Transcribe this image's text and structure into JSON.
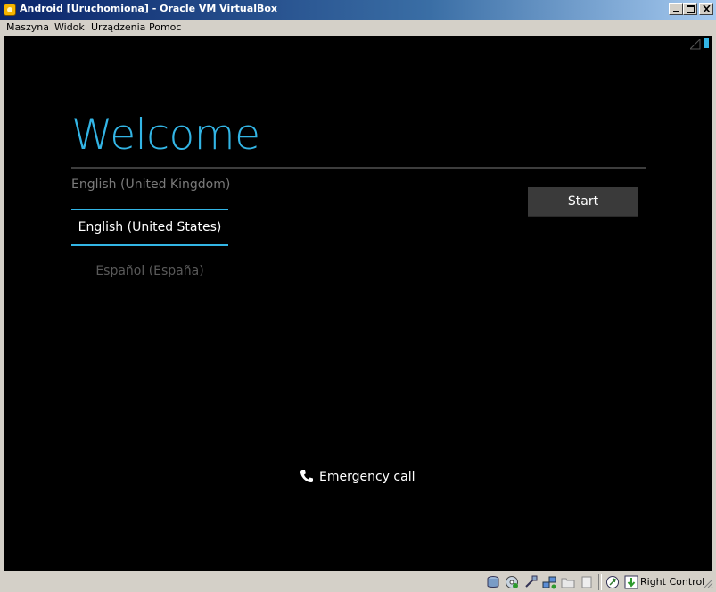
{
  "window": {
    "title": "Android [Uruchomiona] - Oracle VM VirtualBox"
  },
  "menu": {
    "items": [
      "Maszyna",
      "Widok",
      "Urządzenia",
      "Pomoc"
    ]
  },
  "android": {
    "welcome": "Welcome",
    "languages": [
      "English (United Kingdom)",
      "English (United States)",
      "Español (España)"
    ],
    "selected_language": "English (United States)",
    "start_label": "Start",
    "emergency_label": "Emergency call",
    "accent_color": "#33b5e5"
  },
  "statusbar": {
    "icons": [
      "hard-disk-icon",
      "optical-drive-icon",
      "usb-icon",
      "network-icon",
      "shared-folders-icon",
      "capture-icon",
      "mouse-integration-icon",
      "keyboard-capture-icon"
    ],
    "host_key": "Right Control"
  }
}
